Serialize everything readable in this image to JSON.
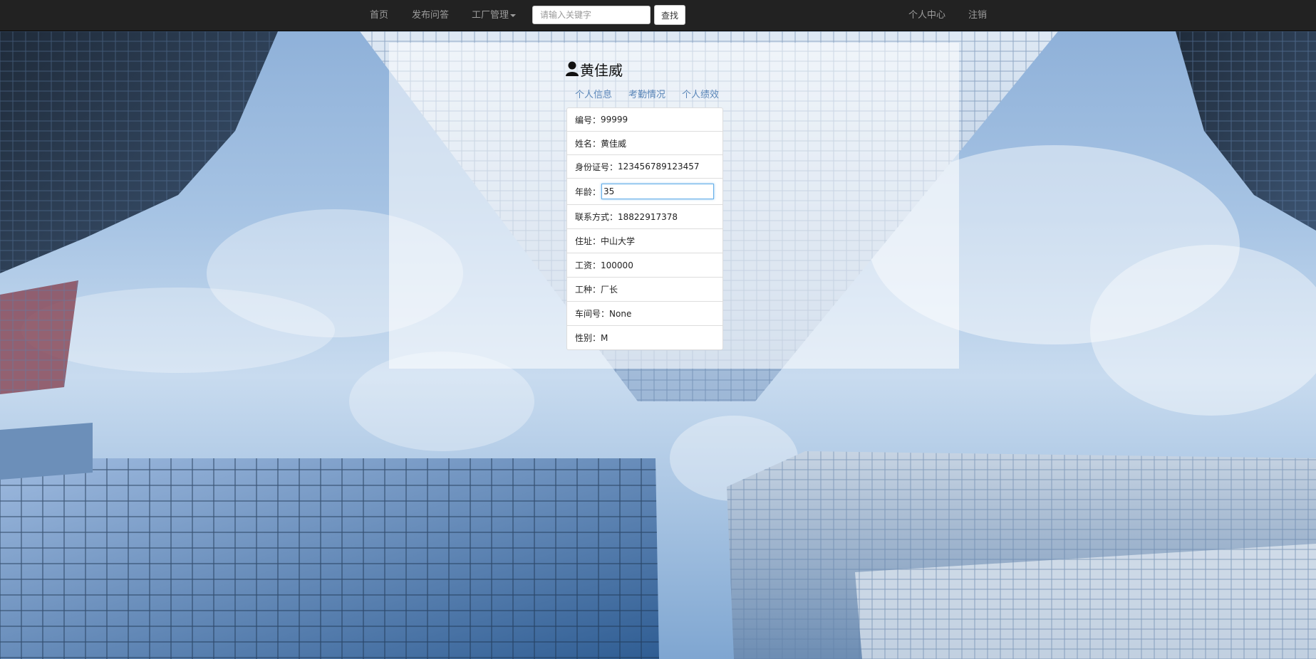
{
  "navbar": {
    "home": "首页",
    "post_question": "发布问答",
    "factory_management": "工厂管理",
    "search_placeholder": "请输入关键字",
    "search_button": "查找",
    "personal_center": "个人中心",
    "logout": "注销"
  },
  "profile": {
    "name": "黄佳威",
    "tabs": [
      "个人信息",
      "考勤情况",
      "个人绩效"
    ]
  },
  "info": {
    "id_label": "编号：",
    "id_value": "99999",
    "name_label": "姓名：",
    "name_value": "黄佳威",
    "idcard_label": "身份证号：",
    "idcard_value": "123456789123457",
    "age_label": "年龄：",
    "age_value": "35",
    "contact_label": "联系方式：",
    "contact_value": "18822917378",
    "address_label": "住址：",
    "address_value": "中山大学",
    "salary_label": "工资：",
    "salary_value": "100000",
    "job_label": "工种：",
    "job_value": "厂长",
    "workshop_label": "车间号：",
    "workshop_value": "None",
    "gender_label": "性别：",
    "gender_value": "M"
  },
  "colors": {
    "navbar_bg": "#222222",
    "nav_text": "#9d9d9d",
    "tab_link": "#5a86b8",
    "focus_border": "#66afe9"
  },
  "icons": {
    "user": "user-icon",
    "caret": "caret-down-icon"
  }
}
